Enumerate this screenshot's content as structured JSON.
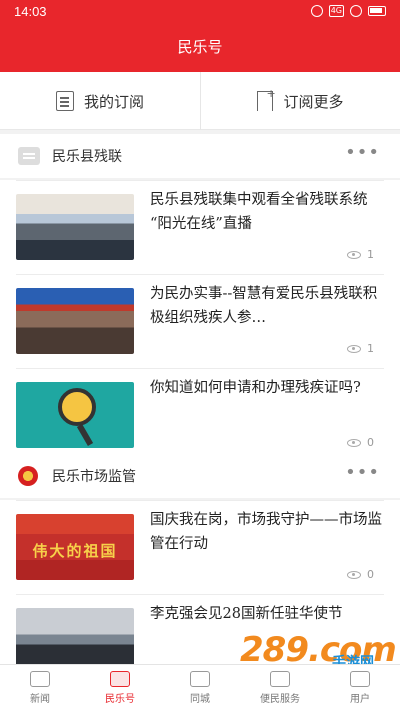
{
  "status_bar": {
    "time": "14:03",
    "network": "4G",
    "battery_icon": "battery-icon",
    "wifi_icon": "wifi-icon"
  },
  "header": {
    "title": "民乐号"
  },
  "subscribe_bar": {
    "my_subscriptions": "我的订阅",
    "subscribe_more": "订阅更多"
  },
  "sections": [
    {
      "title": "民乐县残联",
      "more": "•••",
      "items": [
        {
          "headline": "民乐县残联集中观看全省残联系统 “阳光在线”直播",
          "views": "1"
        },
        {
          "headline": "为民办实事--智慧有爱民乐县残联积极组织残疾人参…",
          "views": "1"
        },
        {
          "headline": "你知道如何申请和办理残疾证吗?",
          "views": "0"
        }
      ]
    },
    {
      "title": "民乐市场监管",
      "more": "•••",
      "items": [
        {
          "headline": "国庆我在岗，市场我守护——市场监管在行动",
          "views": "0",
          "thumb_text": "伟大的祖国"
        },
        {
          "headline": "李克强会见28国新任驻华使节",
          "views": ""
        }
      ]
    }
  ],
  "watermark": {
    "big": "289.com",
    "small": "手游网"
  },
  "tabbar": {
    "items": [
      {
        "label": "新闻"
      },
      {
        "label": "民乐号"
      },
      {
        "label": "同城"
      },
      {
        "label": "便民服务"
      },
      {
        "label": "用户"
      }
    ],
    "active_index": 1
  },
  "colors": {
    "brand_red": "#e8262c"
  }
}
